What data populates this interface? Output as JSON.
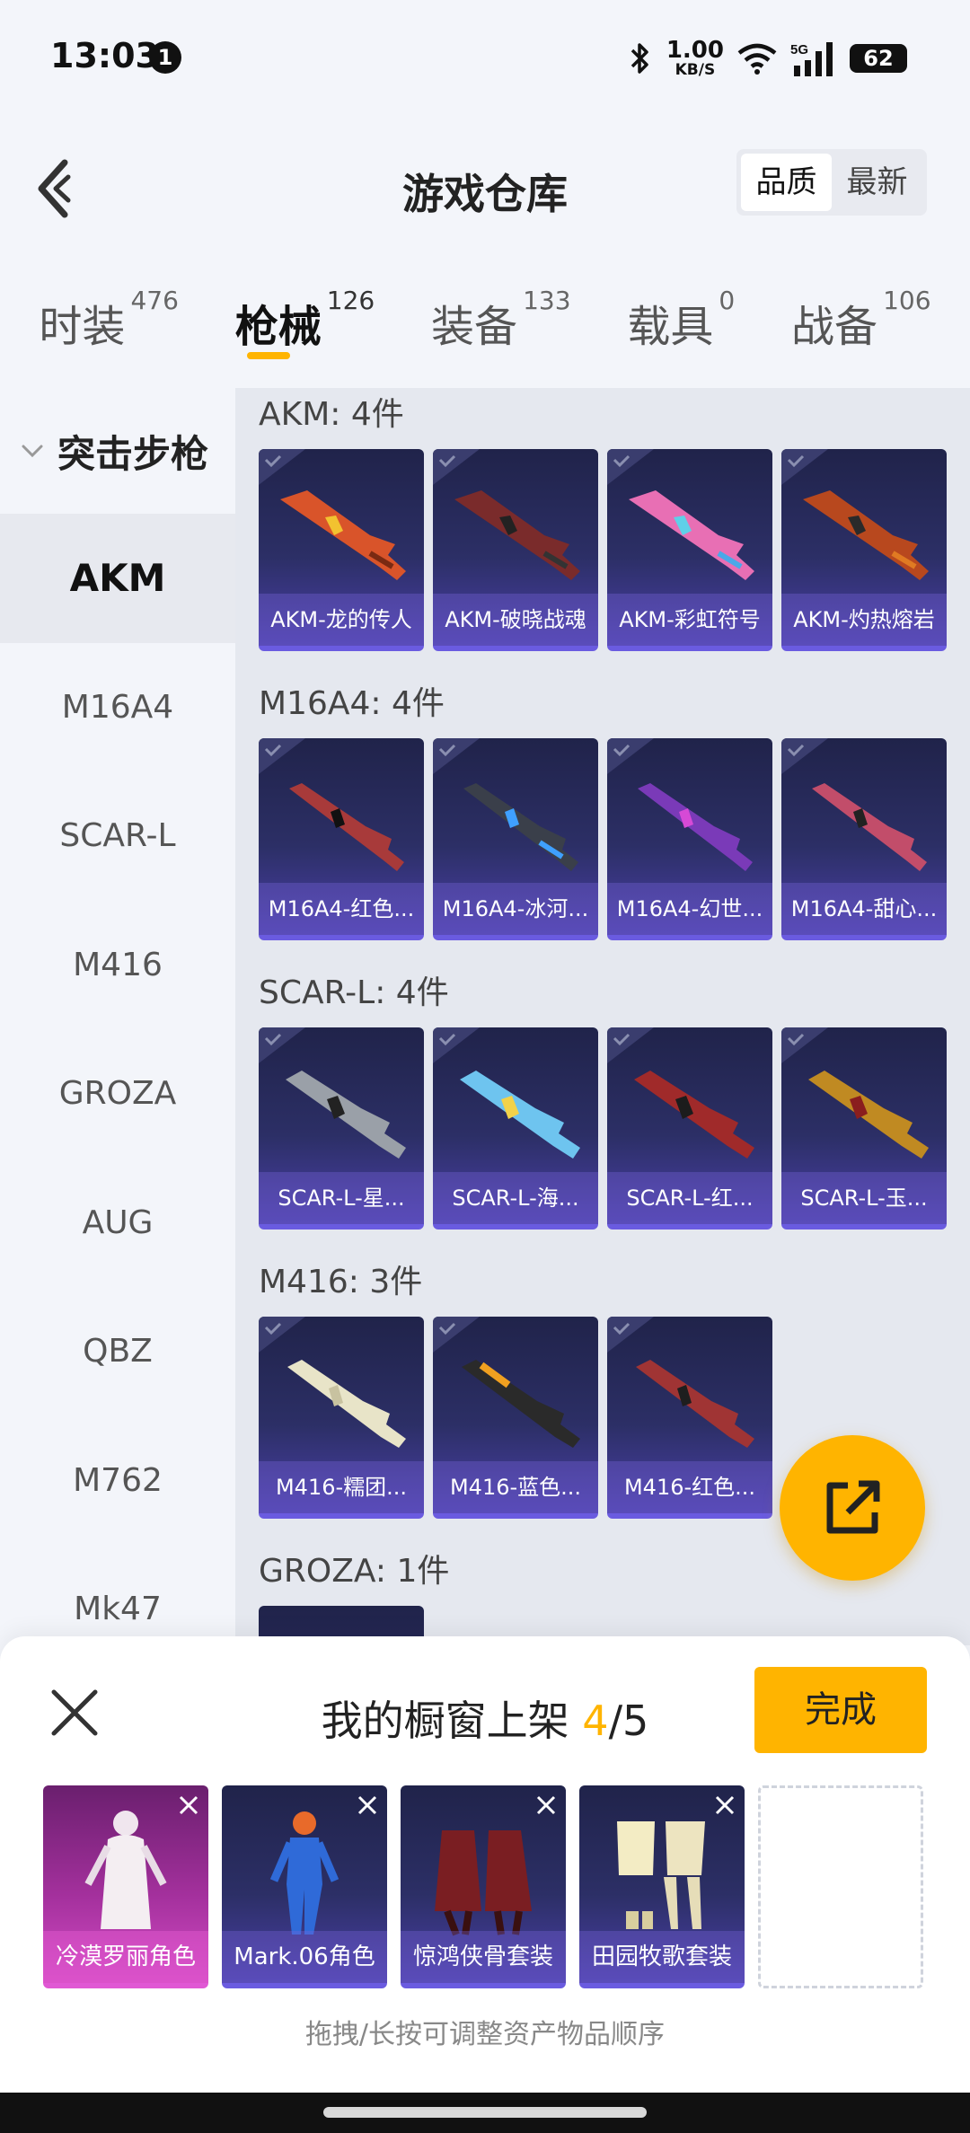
{
  "status_bar": {
    "time": "13:03",
    "notification_count": "1",
    "speed_value": "1.00",
    "speed_unit": "KB/S",
    "network": "5G",
    "battery": "62"
  },
  "header": {
    "title": "游戏仓库",
    "sort_options": [
      "品质",
      "最新"
    ]
  },
  "tabs": [
    {
      "label": "时装",
      "count": "476"
    },
    {
      "label": "枪械",
      "count": "126"
    },
    {
      "label": "装备",
      "count": "133"
    },
    {
      "label": "载具",
      "count": "0"
    },
    {
      "label": "战备",
      "count": "106"
    }
  ],
  "sidebar": {
    "group": "突击步枪",
    "items": [
      "AKM",
      "M16A4",
      "SCAR-L",
      "M416",
      "GROZA",
      "AUG",
      "QBZ",
      "M762",
      "Mk47"
    ]
  },
  "sections": [
    {
      "title": "AKM: 4件",
      "cards": [
        "AKM-龙的传人",
        "AKM-破晓战魂",
        "AKM-彩虹符号",
        "AKM-灼热熔岩"
      ]
    },
    {
      "title": "M16A4: 4件",
      "cards": [
        "M16A4-红色...",
        "M16A4-冰河...",
        "M16A4-幻世...",
        "M16A4-甜心..."
      ]
    },
    {
      "title": "SCAR-L: 4件",
      "cards": [
        "SCAR-L-星...",
        "SCAR-L-海...",
        "SCAR-L-红...",
        "SCAR-L-玉..."
      ]
    },
    {
      "title": "M416: 3件",
      "cards": [
        "M416-糯团...",
        "M416-蓝色...",
        "M416-红色..."
      ]
    },
    {
      "title": "GROZA: 1件",
      "cards": []
    }
  ],
  "sheet": {
    "title_prefix": "我的橱窗上架 ",
    "count": "4",
    "total": "/5",
    "done_label": "完成",
    "items": [
      "冷漠罗丽角色",
      "Mark.06角色",
      "惊鸿侠骨套装",
      "田园牧歌套装"
    ],
    "hint": "拖拽/长按可调整资产物品顺序"
  },
  "colors": {
    "accent": "#ffb400",
    "card_bg": "#2c2f66",
    "card_border": "#6a5be0"
  }
}
